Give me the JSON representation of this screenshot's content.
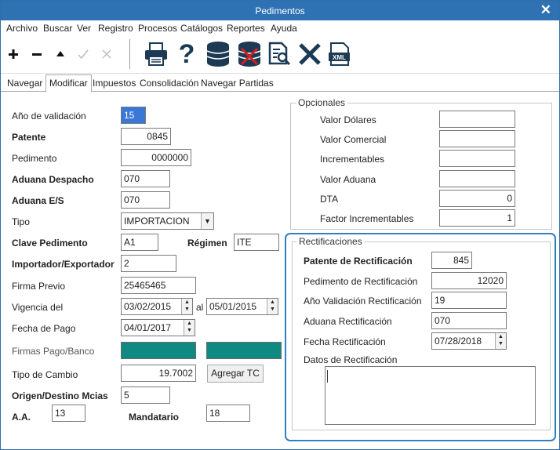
{
  "window": {
    "title": "Pedimentos"
  },
  "menu": [
    "Archivo",
    "Buscar",
    "Ver",
    "Registro",
    "Procesos",
    "Catálogos",
    "Reportes",
    "Ayuda"
  ],
  "toolbar_icons": [
    "plus-icon",
    "minus-icon",
    "triangle-up-icon",
    "check-icon",
    "cancel-icon",
    "printer-icon",
    "help-icon",
    "database-icon",
    "database-delete-icon",
    "search-document-icon",
    "close-icon",
    "xml-icon"
  ],
  "tabs": [
    "Navegar",
    "Modificar",
    "Impuestos",
    "Consolidación",
    "Navegar Partidas"
  ],
  "form": {
    "anio_validacion": {
      "label": "Año de validación",
      "value": "15"
    },
    "patente": {
      "label": "Patente",
      "value": "0845"
    },
    "pedimento": {
      "label": "Pedimento",
      "value": "0000000"
    },
    "aduana_despacho": {
      "label": "Aduana Despacho",
      "value": "070"
    },
    "aduana_es": {
      "label": "Aduana E/S",
      "value": "070"
    },
    "tipo": {
      "label": "Tipo",
      "value": "IMPORTACION"
    },
    "clave_pedimento": {
      "label": "Clave Pedimento",
      "value": "A1"
    },
    "regimen": {
      "label": "Régimen",
      "value": "ITE"
    },
    "importador": {
      "label": "Importador/Exportador",
      "value": "2"
    },
    "firma_previo": {
      "label": "Firma Previo",
      "value": "25465465"
    },
    "vigencia": {
      "label": "Vigencia del",
      "from": "03/02/2015",
      "sep": "al",
      "to": "05/01/2015"
    },
    "fecha_pago": {
      "label": "Fecha de Pago",
      "value": "04/01/2017"
    },
    "firmas": {
      "label": "Firmas Pago/Banco"
    },
    "tipo_cambio": {
      "label": "Tipo de Cambio",
      "value": "19.7002",
      "button": "Agregar TC"
    },
    "origen_destino": {
      "label": "Origen/Destino Mcias",
      "value": "5"
    },
    "aa": {
      "label": "A.A.",
      "value": "13"
    },
    "mandatario": {
      "label": "Mandatario",
      "value": "18"
    }
  },
  "opcionales": {
    "title": "Opcionales",
    "rows": [
      {
        "label": "Valor Dólares",
        "value": ""
      },
      {
        "label": "Valor Comercial",
        "value": ""
      },
      {
        "label": "Incrementables",
        "value": ""
      },
      {
        "label": "Valor Aduana",
        "value": ""
      },
      {
        "label": "DTA",
        "value": "0"
      },
      {
        "label": "Factor Incrementables",
        "value": "1"
      }
    ]
  },
  "rectificaciones": {
    "title": "Rectificaciones",
    "patente": {
      "label": "Patente de Rectificación",
      "value": "845"
    },
    "pedimento": {
      "label": "Pedimento de Rectificación",
      "value": "12020"
    },
    "anio": {
      "label": "Año Validación Rectificación",
      "value": "19"
    },
    "aduana": {
      "label": "Aduana Rectificación",
      "value": "070"
    },
    "fecha": {
      "label": "Fecha Rectificación",
      "value": "07/28/2018"
    },
    "datos": {
      "label": "Datos de Rectificación",
      "value": ""
    }
  }
}
